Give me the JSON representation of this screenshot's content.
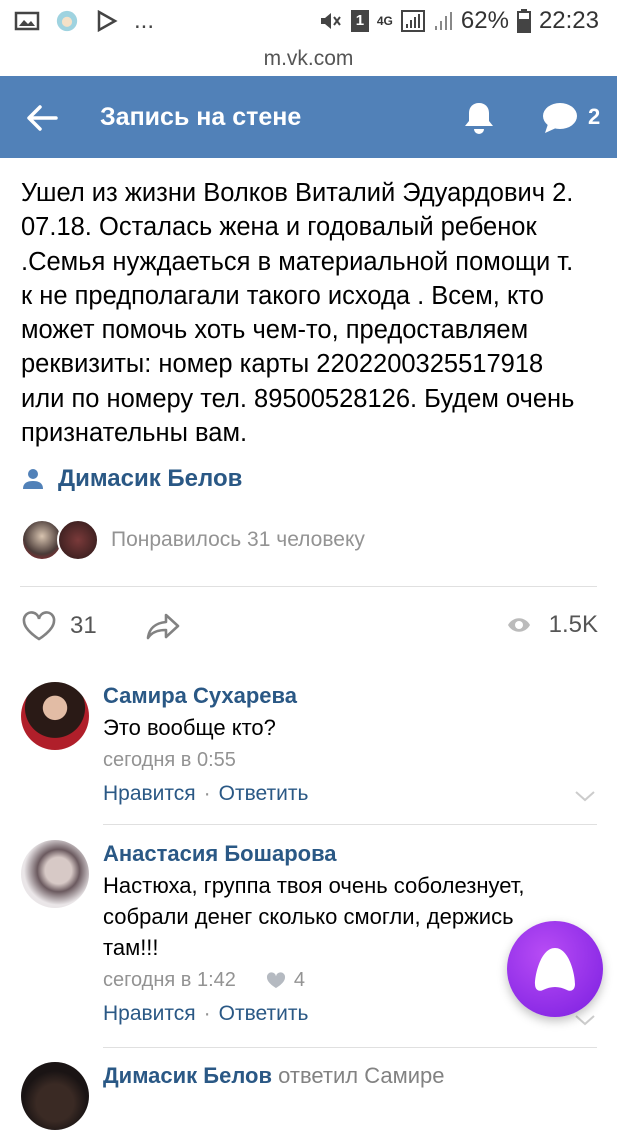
{
  "status_bar": {
    "battery_percent": "62%",
    "time": "22:23",
    "network": "4G",
    "sim": "1",
    "dots": "..."
  },
  "url": "m.vk.com",
  "header": {
    "title": "Запись на стене",
    "comments_count": "2",
    "accent": "#5181b8"
  },
  "post": {
    "lines": [
      "Ушел из жизни Волков Виталий Эдуардович 2.",
      "07.18. Осталась жена и годовалый ребенок",
      ".Семья нуждаеться в материальной помощи т.",
      "к не предполагали такого исхода . Всем, кто",
      "может помочь хоть чем-то, предоставляем",
      "реквизиты: номер карты 2202200325517918",
      "или по номеру тел. 89500528126. Будем очень",
      "признательны вам."
    ],
    "author": "Димасик Белов",
    "likes_text": "Понравилось 31 человеку",
    "like_count": "31",
    "views": "1.5K"
  },
  "comments": [
    {
      "name": "Самира Сухарева",
      "text_lines": [
        "Это вообще кто?"
      ],
      "date": "сегодня в 0:55",
      "likes": "",
      "like_label": "Нравится",
      "reply_label": "Ответить"
    },
    {
      "name": "Анастасия Бошарова",
      "text_lines": [
        "Настюха, группа твоя очень соболезнует,",
        "собрали денег сколько смогли, держись",
        "там!!!"
      ],
      "date": "сегодня в 1:42",
      "likes": "4",
      "like_label": "Нравится",
      "reply_label": "Ответить"
    },
    {
      "name": "Димасик Белов",
      "replied": "ответил Самире"
    }
  ],
  "sep": "·"
}
